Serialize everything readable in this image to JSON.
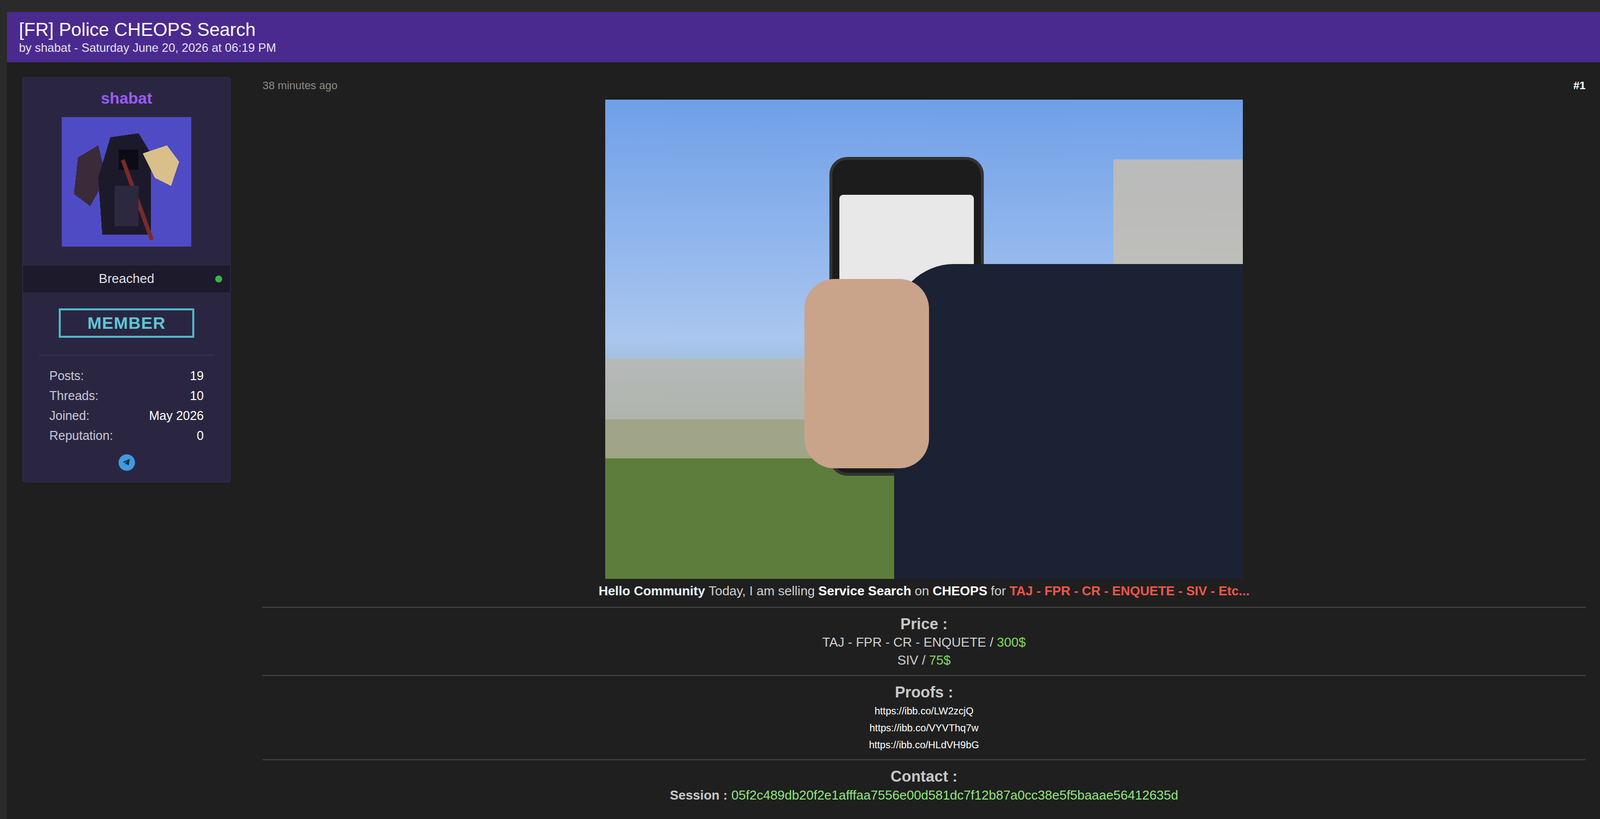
{
  "thread": {
    "title": "[FR] Police CHEOPS Search",
    "byline": "by shabat - Saturday June 20, 2026 at 06:19 PM"
  },
  "user": {
    "name": "shabat",
    "status": "Breached",
    "online": true,
    "badge": "MEMBER",
    "stats": [
      {
        "label": "Posts:",
        "value": "19"
      },
      {
        "label": "Threads:",
        "value": "10"
      },
      {
        "label": "Joined:",
        "value": "May 2026"
      },
      {
        "label": "Reputation:",
        "value": "0"
      }
    ]
  },
  "post": {
    "time": "38 minutes ago",
    "number": "#1",
    "intro": [
      {
        "text": "Hello Community",
        "kind": "highlight"
      },
      {
        "text": "Today, I am selling",
        "kind": "plain"
      },
      {
        "text": "Service Search",
        "kind": "strong"
      },
      {
        "text": "on",
        "kind": "plain"
      },
      {
        "text": "CHEOPS",
        "kind": "strong"
      },
      {
        "text": "for",
        "kind": "plain"
      },
      {
        "text": "TAJ - FPR - CR - ENQUETE - SIV - Etc...",
        "kind": "alert"
      }
    ],
    "price": {
      "heading": "Price :",
      "items": [
        {
          "label": "TAJ - FPR - CR - ENQUETE /",
          "value": "300$"
        },
        {
          "label": "SIV /",
          "value": "75$"
        }
      ]
    },
    "proofs": {
      "heading": "Proofs :",
      "links": [
        "https://ibb.co/LW2zcjQ",
        "https://ibb.co/VYVThq7w",
        "https://ibb.co/HLdVH9bG"
      ]
    },
    "contact": {
      "heading": "Contact :",
      "label": "Session :",
      "value": "05f2c489db20f2e1afffaa7556e00d581dc7f12b87a0cc38e5f5baaae56412635d"
    }
  }
}
